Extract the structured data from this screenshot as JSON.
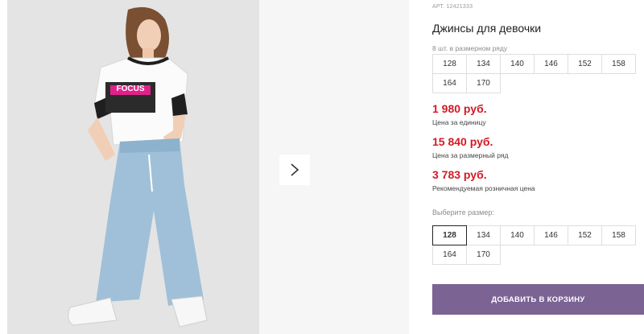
{
  "product": {
    "article_label": "АРТ.",
    "article_number": "12421333",
    "title": "Джинсы для девочки"
  },
  "pack": {
    "label": "8 шт. в размерном ряду",
    "sizes": [
      "128",
      "134",
      "140",
      "146",
      "152",
      "158",
      "164",
      "170"
    ]
  },
  "prices": [
    {
      "value": "1 980 руб.",
      "caption": "Цена за единицу"
    },
    {
      "value": "15 840 руб.",
      "caption": "Цена за размерный ряд"
    },
    {
      "value": "3 783 руб.",
      "caption": "Рекомендуемая розничная цена"
    }
  ],
  "size_select": {
    "label": "Выберите размер:",
    "sizes": [
      "128",
      "134",
      "140",
      "146",
      "152",
      "158",
      "164",
      "170"
    ],
    "selected": "128"
  },
  "cart": {
    "label": "ДОБАВИТЬ В КОРЗИНУ"
  },
  "photo": {
    "tshirt_print": "FOCUS"
  },
  "icons": {
    "next": "chevron-right-icon"
  },
  "colors": {
    "price": "#d31a26",
    "cart_button": "#7b6394"
  }
}
